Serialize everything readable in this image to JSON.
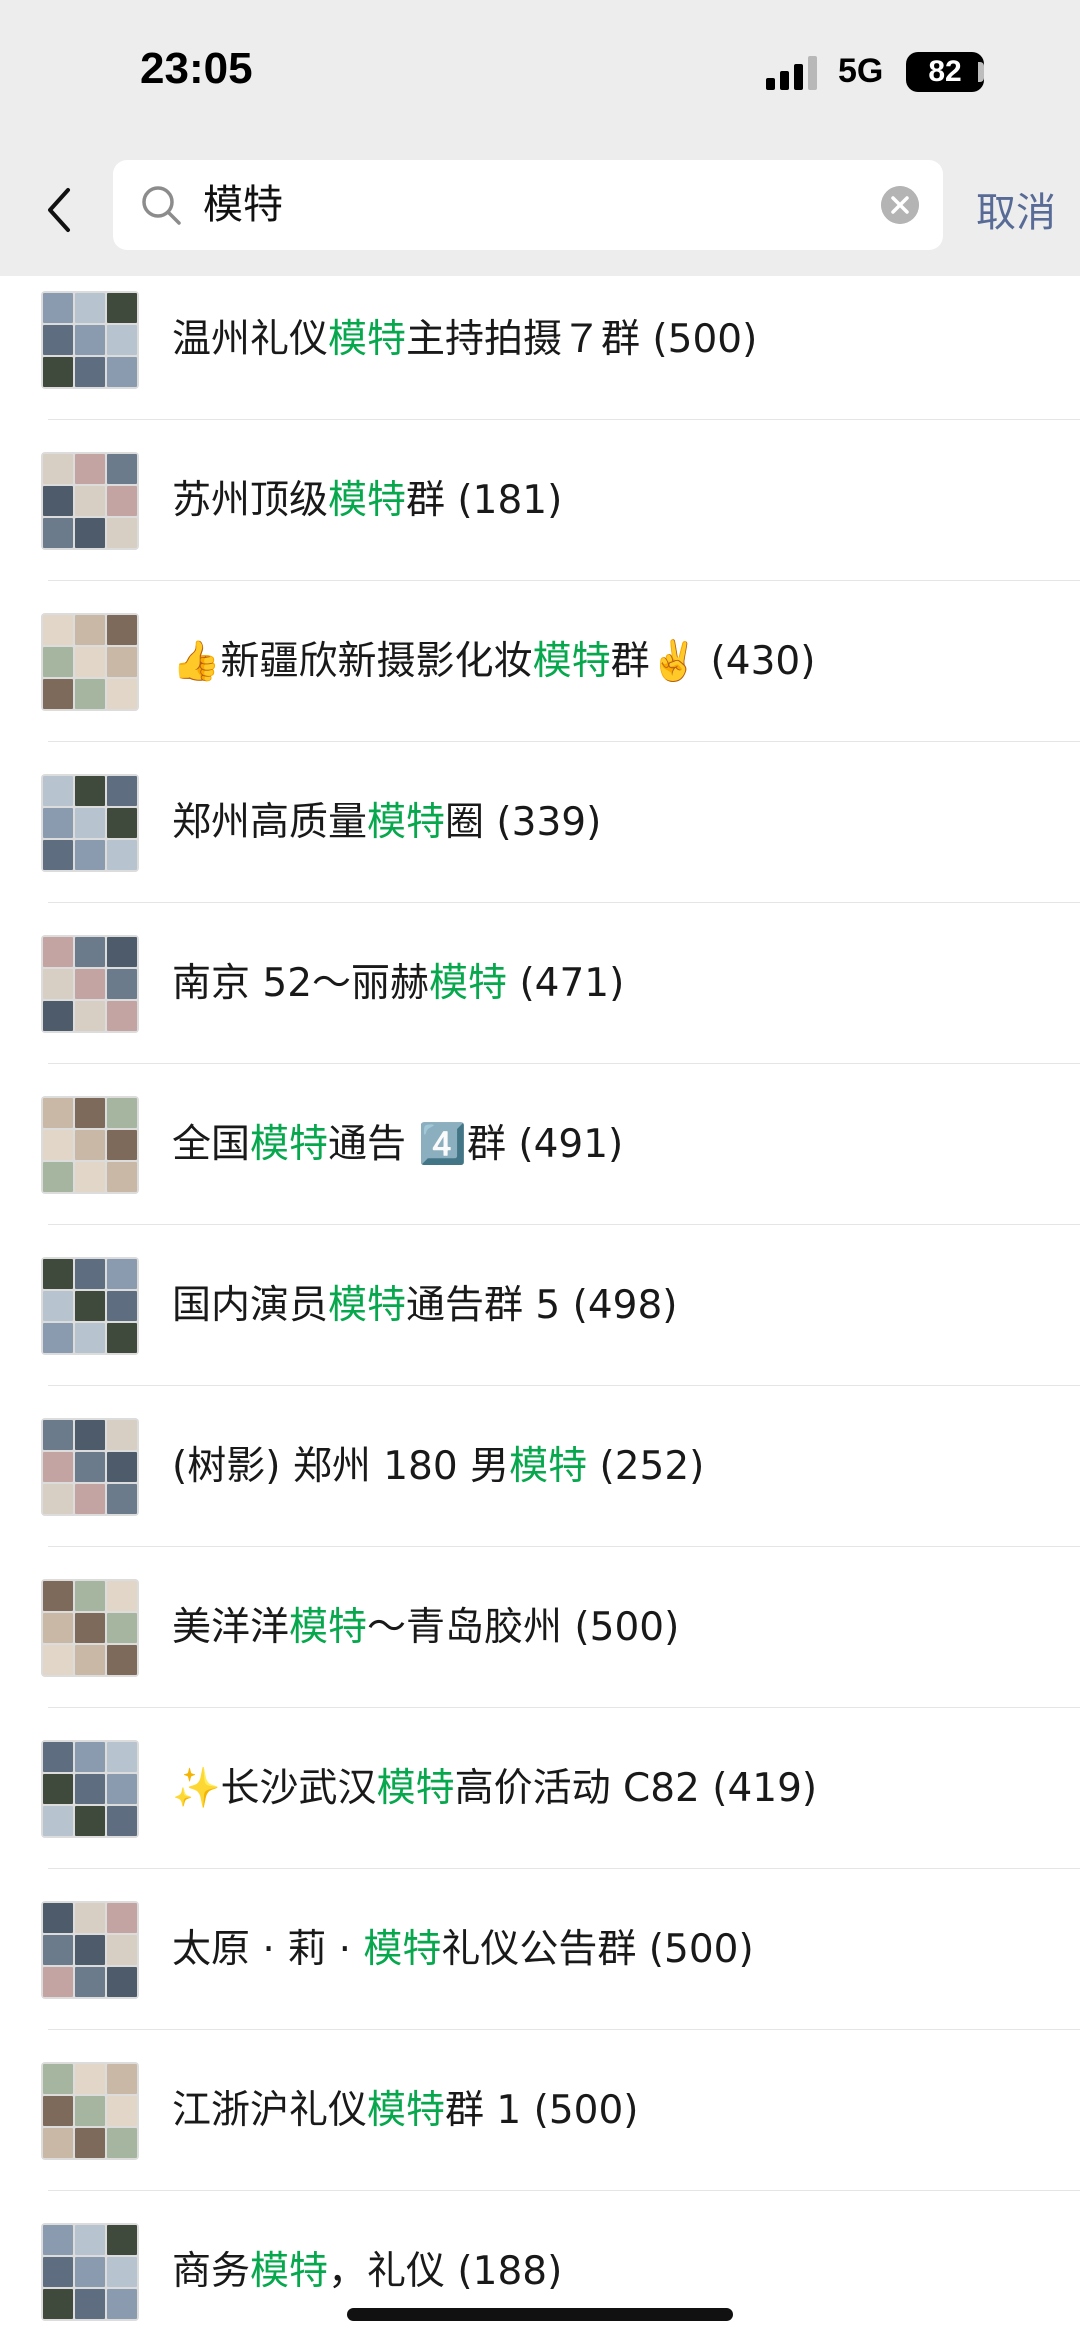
{
  "status_bar": {
    "time": "23:05",
    "network": "5G",
    "battery": "82"
  },
  "search": {
    "query": "模特",
    "cancel_label": "取消"
  },
  "colors": {
    "highlight": "#07a84d",
    "cancel": "#586b96"
  },
  "results": [
    {
      "pre": "温州礼仪",
      "kw": "模特",
      "post": "主持拍摄７群 (500)"
    },
    {
      "pre": "苏州顶级",
      "kw": "模特",
      "post": "群 (181)"
    },
    {
      "pre": "👍新疆欣新摄影化妆",
      "kw": "模特",
      "post": "群✌️ (430)"
    },
    {
      "pre": "郑州高质量",
      "kw": "模特",
      "post": "圈 (339)"
    },
    {
      "pre": "南京 52～丽赫",
      "kw": "模特",
      "post": " (471)"
    },
    {
      "pre": "全国",
      "kw": "模特",
      "post": "通告 4️⃣群 (491)"
    },
    {
      "pre": "国内演员",
      "kw": "模特",
      "post": "通告群 5 (498)"
    },
    {
      "pre": "(树影) 郑州 180 男",
      "kw": "模特",
      "post": " (252)"
    },
    {
      "pre": "美洋洋",
      "kw": "模特",
      "post": "～青岛胶州 (500)"
    },
    {
      "pre": "✨长沙武汉",
      "kw": "模特",
      "post": "高价活动 C82 (419)"
    },
    {
      "pre": "太原 · 莉 · ",
      "kw": "模特",
      "post": "礼仪公告群 (500)"
    },
    {
      "pre": "江浙沪礼仪",
      "kw": "模特",
      "post": "群 1 (500)"
    },
    {
      "pre": "商务",
      "kw": "模特",
      "post": "，礼仪 (188)"
    }
  ]
}
